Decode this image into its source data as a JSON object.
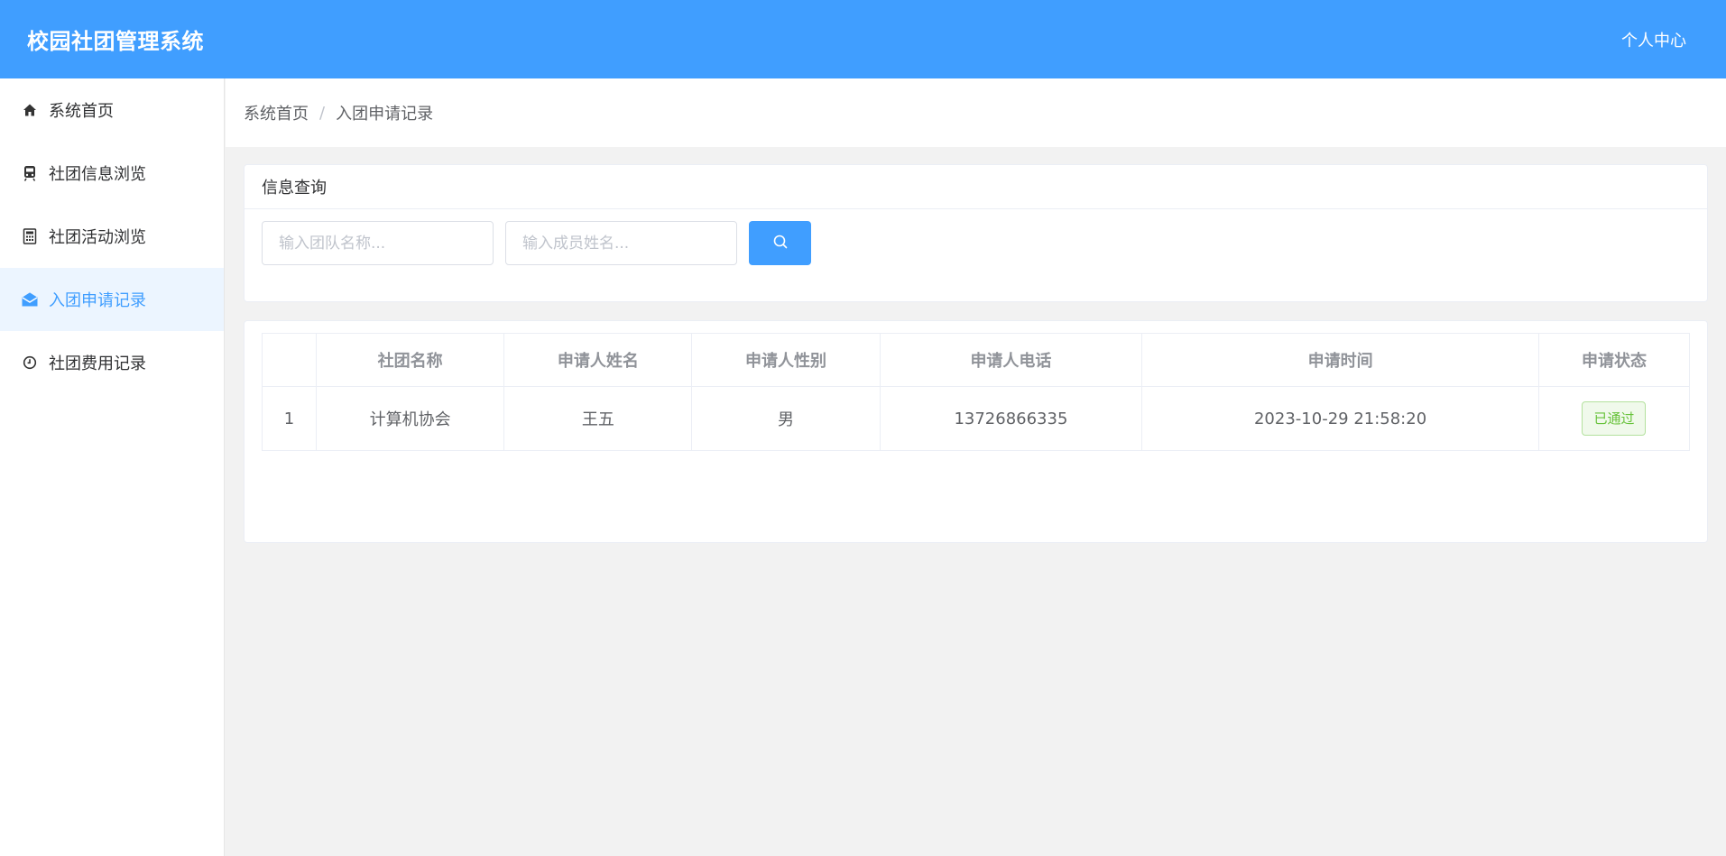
{
  "header": {
    "title": "校园社团管理系统",
    "user_center": "个人中心"
  },
  "sidebar": {
    "items": [
      {
        "label": "系统首页",
        "icon": "home-icon"
      },
      {
        "label": "社团信息浏览",
        "icon": "train-icon"
      },
      {
        "label": "社团活动浏览",
        "icon": "calculator-icon"
      },
      {
        "label": "入团申请记录",
        "icon": "envelope-open-icon",
        "active": true
      },
      {
        "label": "社团费用记录",
        "icon": "clock-icon"
      }
    ]
  },
  "breadcrumb": {
    "home": "系统首页",
    "separator": "/",
    "current": "入团申请记录"
  },
  "search": {
    "title": "信息查询",
    "team_placeholder": "输入团队名称...",
    "member_placeholder": "输入成员姓名..."
  },
  "table": {
    "columns": [
      "",
      "社团名称",
      "申请人姓名",
      "申请人性别",
      "申请人电话",
      "申请时间",
      "申请状态"
    ],
    "rows": [
      {
        "index": "1",
        "club": "计算机协会",
        "name": "王五",
        "gender": "男",
        "phone": "13726866335",
        "time": "2023-10-29 21:58:20",
        "status": "已通过"
      }
    ]
  },
  "colors": {
    "primary": "#409eff",
    "success": "#67c23a"
  }
}
